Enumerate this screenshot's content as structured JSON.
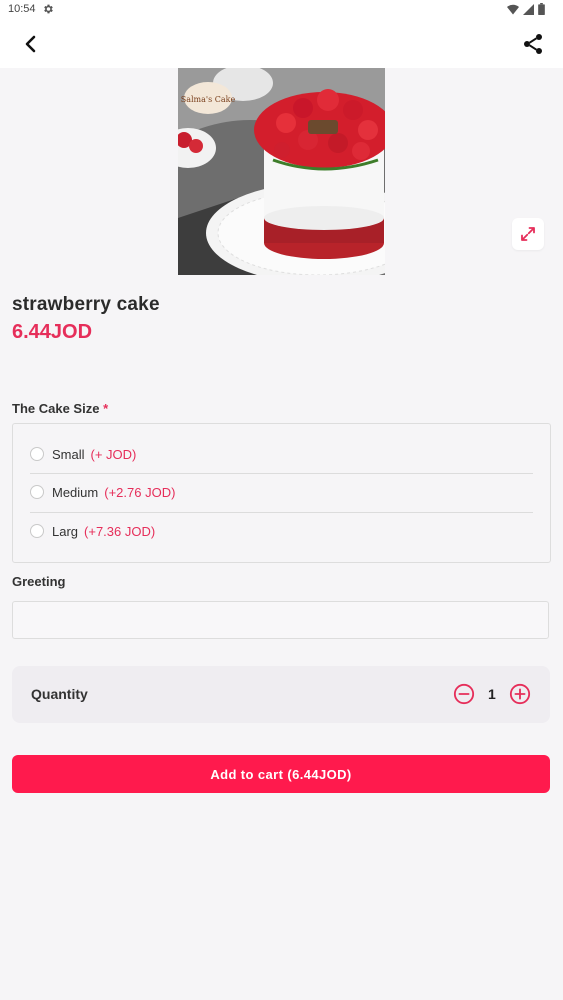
{
  "status_bar": {
    "time": "10:54"
  },
  "product": {
    "name": "strawberry cake",
    "price": "6.44JOD",
    "image_caption": "Salma's Cake"
  },
  "size_section": {
    "label": "The Cake Size",
    "required_mark": "*",
    "options": [
      {
        "name": "Small",
        "extra": "(+ JOD)",
        "selected": false
      },
      {
        "name": "Medium",
        "extra": "(+2.76 JOD)",
        "selected": false
      },
      {
        "name": "Larg",
        "extra": "(+7.36 JOD)",
        "selected": false
      }
    ]
  },
  "greeting": {
    "label": "Greeting",
    "value": "",
    "placeholder": ""
  },
  "quantity": {
    "label": "Quantity",
    "value": "1"
  },
  "add_to_cart": {
    "label": "Add to cart (6.44JOD)"
  },
  "colors": {
    "accent": "#e62e5a",
    "button": "#ff1a4d",
    "background": "#f6f5f7"
  },
  "icons": {
    "back": "back-arrow-icon",
    "share": "share-icon",
    "expand": "expand-icon",
    "minus": "minus-circle-icon",
    "plus": "plus-circle-icon",
    "settings": "gear-icon"
  }
}
